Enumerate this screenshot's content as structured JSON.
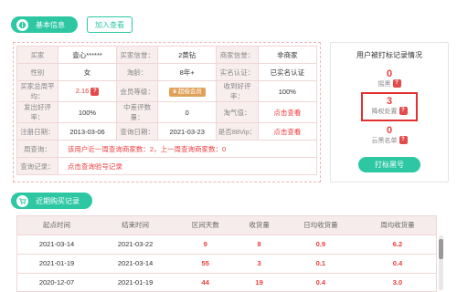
{
  "basic": {
    "title": "基本信息",
    "add_blacklist": "加入查看"
  },
  "info": {
    "r1": {
      "l1": "买家",
      "v1": "壹心******",
      "l2": "买家信誉：",
      "v2": "2黄钻",
      "l3": "商家信誉：",
      "v3": "非商家"
    },
    "r2": {
      "l1": "性别",
      "v1": "女",
      "l2": "淘龄：",
      "v2": "8年+",
      "l3": "实名认证：",
      "v3": "已实名认证"
    },
    "r3": {
      "l1": "买家总周平均：",
      "v1": "2.16",
      "l2": "会员等级：",
      "v2": "超级会员",
      "l3": "收到好评率：",
      "v3": "100%"
    },
    "r4": {
      "l1": "发出好评率：",
      "v1": "100%",
      "l2": "中差评数量：",
      "v2": "0",
      "l3": "淘气值：",
      "v3": "点击查看"
    },
    "r5": {
      "l1": "注册日期：",
      "v1": "2013-03-06",
      "l2": "查询日期：",
      "v2": "2021-03-23",
      "l3": "是否88Vip：",
      "v3": "点击查看"
    },
    "r6": {
      "l1": "周查询：",
      "v1": "该用户近一周查询商家数：2，上一周查询商家数：0"
    },
    "r7": {
      "l1": "查询记录：",
      "v1": "点击查询验号记录"
    }
  },
  "marks": {
    "title": "用户被打标记录情况",
    "m1": {
      "num": "0",
      "label": "摇黑"
    },
    "m2": {
      "num": "3",
      "label": "降权处置"
    },
    "m3": {
      "num": "0",
      "label": "云黑名单"
    },
    "button": "打标黑号"
  },
  "recent": {
    "title": "近期购买记录"
  },
  "records": {
    "headers": [
      "起点时间",
      "结束时间",
      "区间天数",
      "收货量",
      "日均收货量",
      "周均收货量"
    ],
    "rows": [
      [
        "2021-03-14",
        "2021-03-22",
        "9",
        "8",
        "0.9",
        "6.2"
      ],
      [
        "2021-01-19",
        "2021-03-14",
        "55",
        "3",
        "0.1",
        "0.4"
      ],
      [
        "2020-12-07",
        "2021-01-19",
        "44",
        "19",
        "0.4",
        "3.0"
      ]
    ]
  },
  "colors": {
    "accent": "#2dc7a4",
    "red": "#ec3c3c",
    "label_bg": "#f8eeee"
  }
}
